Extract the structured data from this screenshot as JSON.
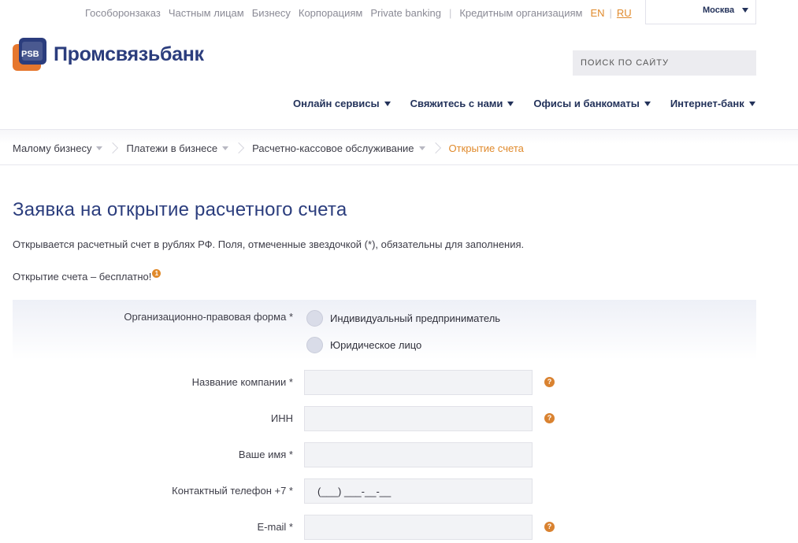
{
  "top_nav": {
    "items": [
      "Гособоронзаказ",
      "Частным лицам",
      "Бизнесу",
      "Корпорациям",
      "Private banking"
    ],
    "credit_orgs": "Кредитным организациям",
    "lang_en": "EN",
    "lang_divider": "|",
    "lang_ru": "RU"
  },
  "city": {
    "label": "Москва",
    "icon": "chevron-down-icon"
  },
  "logo": {
    "text": "Промсвязьбанк",
    "icon": "psb-logo-icon",
    "colors": {
      "orange": "#e6772e",
      "blue": "#2b3d7d"
    }
  },
  "search": {
    "placeholder": "ПОИСК ПО САЙТУ"
  },
  "main_nav": {
    "items": [
      {
        "label": "Онлайн сервисы"
      },
      {
        "label": "Свяжитесь с нами"
      },
      {
        "label": "Офисы и банкоматы"
      },
      {
        "label": "Интернет-банк"
      }
    ]
  },
  "breadcrumb": {
    "items": [
      {
        "label": "Малому бизнесу"
      },
      {
        "label": "Платежи в бизнесе"
      },
      {
        "label": "Расчетно-кассовое обслуживание"
      }
    ],
    "current": "Открытие счета"
  },
  "page": {
    "title": "Заявка на открытие расчетного счета",
    "subtitle": "Открывается расчетный счет в рублях РФ. Поля, отмеченные звездочкой (*), обязательны для заполнения.",
    "free_note": "Открытие счета – бесплатно!",
    "footnote_mark": "1"
  },
  "form": {
    "legal_form": {
      "label": "Организационно-правовая форма *",
      "options": [
        "Индивидуальный предприниматель",
        "Юридическое лицо"
      ]
    },
    "company_name": {
      "label": "Название компании *",
      "value": "",
      "help": "?"
    },
    "inn": {
      "label": "ИНН",
      "value": "",
      "help": "?"
    },
    "your_name": {
      "label": "Ваше имя *",
      "value": ""
    },
    "phone": {
      "label": "Контактный телефон +7 *",
      "value": "(___) ___-__-__"
    },
    "email": {
      "label": "E-mail *",
      "value": "",
      "help": "?"
    }
  },
  "colors": {
    "accent_orange": "#e08a2c",
    "brand_blue": "#2b3d7d",
    "nav_dark": "#23325a"
  }
}
